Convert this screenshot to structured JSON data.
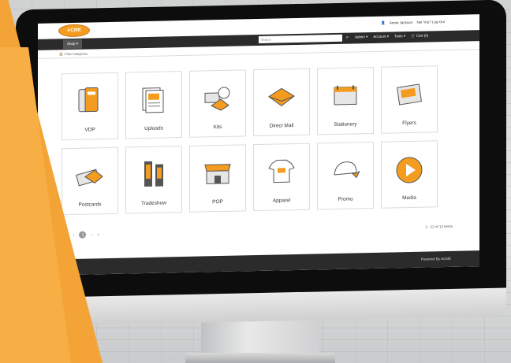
{
  "brand": {
    "logo_text": "ACME",
    "accent": "#f39c1f",
    "dark": "#2b2b2b"
  },
  "header": {
    "user_name": "Annie Jackson",
    "not_you": "Not You? Log Out"
  },
  "nav": {
    "shop_label": "Shop ▾",
    "search_placeholder": "Search",
    "menu": [
      "Admin ▾",
      "Account ▾",
      "Tools ▾",
      "🛒 Cart (0)"
    ]
  },
  "breadcrumb": "🏠 / Part Categories",
  "categories": [
    {
      "label": "VDP",
      "icon": "vdp-icon"
    },
    {
      "label": "Uploads",
      "icon": "uploads-icon"
    },
    {
      "label": "Kits",
      "icon": "kits-icon"
    },
    {
      "label": "Direct Mail",
      "icon": "direct-mail-icon"
    },
    {
      "label": "Stationery",
      "icon": "stationery-icon"
    },
    {
      "label": "Flyers",
      "icon": "flyers-icon"
    },
    {
      "label": "Postcards",
      "icon": "postcards-icon"
    },
    {
      "label": "Tradeshow",
      "icon": "tradeshow-icon"
    },
    {
      "label": "POP",
      "icon": "pop-icon"
    },
    {
      "label": "Apparel",
      "icon": "apparel-icon"
    },
    {
      "label": "Promo",
      "icon": "promo-icon"
    },
    {
      "label": "Media",
      "icon": "media-icon"
    }
  ],
  "pager": {
    "first": "«",
    "prev": "‹",
    "current": "1",
    "next": "›",
    "last": "»",
    "count_text": "1 - 12 of 12 items"
  },
  "footer": {
    "powered": "Powered By ACME"
  }
}
